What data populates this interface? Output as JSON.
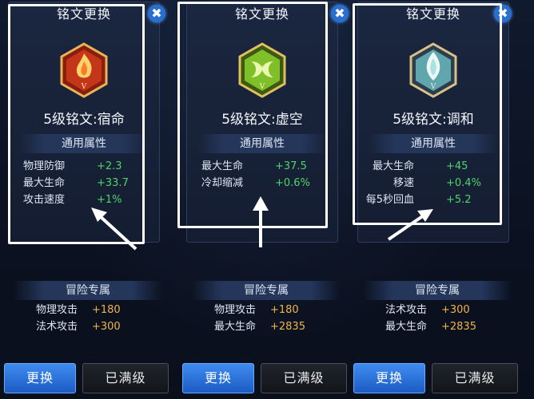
{
  "cards": [
    {
      "title": "铭文更换",
      "rune_name": "5级铭文:宿命",
      "general_header": "通用属性",
      "general_stats": [
        {
          "label": "物理防御",
          "value": "+2.3"
        },
        {
          "label": "最大生命",
          "value": "+33.7"
        },
        {
          "label": "攻击速度",
          "value": "+1%"
        }
      ],
      "adventure_header": "冒险专属",
      "adventure_stats": [
        {
          "label": "物理攻击",
          "value": "+180"
        },
        {
          "label": "法术攻击",
          "value": "+300"
        }
      ],
      "swap_label": "更换",
      "max_label": "已满级",
      "emblem_icon": "red-flame-rune-icon",
      "emblem_color": "#d8431f"
    },
    {
      "title": "铭文更换",
      "rune_name": "5级铭文:虚空",
      "general_header": "通用属性",
      "general_stats": [
        {
          "label": "最大生命",
          "value": "+37.5"
        },
        {
          "label": "冷却缩减",
          "value": "+0.6%"
        }
      ],
      "adventure_header": "冒险专属",
      "adventure_stats": [
        {
          "label": "物理攻击",
          "value": "+180"
        },
        {
          "label": "最大生命",
          "value": "+2835"
        }
      ],
      "swap_label": "更换",
      "max_label": "已满级",
      "emblem_icon": "green-void-rune-icon",
      "emblem_color": "#7fbf2a"
    },
    {
      "title": "铭文更换",
      "rune_name": "5级铭文:调和",
      "general_header": "通用属性",
      "general_stats": [
        {
          "label": "最大生命",
          "value": "+45"
        },
        {
          "label": "移速",
          "value": "+0.4%"
        },
        {
          "label": "每5秒回血",
          "value": "+5.2"
        }
      ],
      "adventure_header": "冒险专属",
      "adventure_stats": [
        {
          "label": "法术攻击",
          "value": "+300"
        },
        {
          "label": "最大生命",
          "value": "+2835"
        }
      ],
      "swap_label": "更换",
      "max_label": "已满级",
      "emblem_icon": "teal-harmony-rune-icon",
      "emblem_color": "#6fc7c9"
    }
  ],
  "close_icon": "close-icon",
  "colors": {
    "stat_green": "#4fd36a",
    "stat_orange": "#f0b44a",
    "button_blue": "#2f79e0"
  }
}
